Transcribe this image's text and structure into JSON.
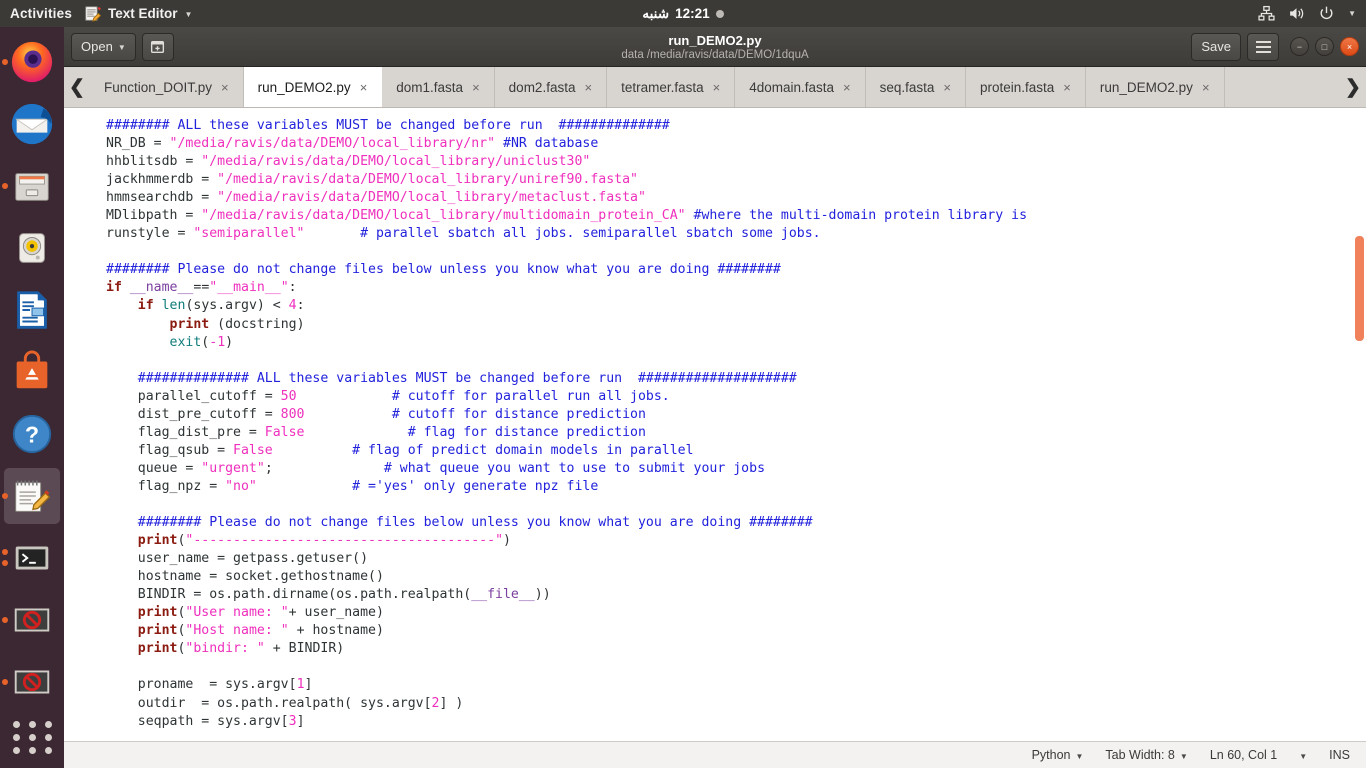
{
  "topbar": {
    "activities": "Activities",
    "app_name": "Text Editor",
    "app_icon": "text-editor-icon",
    "clock": "12:21",
    "clock_day": "شنبه",
    "tray_icons": [
      "network-icon",
      "volume-icon",
      "power-icon",
      "chevron-down-icon"
    ]
  },
  "dock": {
    "items": [
      {
        "name": "firefox",
        "running": true
      },
      {
        "name": "thunderbird",
        "running": false
      },
      {
        "name": "files",
        "running": true
      },
      {
        "name": "rhythmbox",
        "running": false
      },
      {
        "name": "libreoffice-writer",
        "running": false
      },
      {
        "name": "ubuntu-software",
        "running": false
      },
      {
        "name": "help",
        "running": false
      },
      {
        "name": "text-editor",
        "running": true
      },
      {
        "name": "terminal",
        "running": true
      },
      {
        "name": "blocked-window-1",
        "running": true
      },
      {
        "name": "blocked-window-2",
        "running": true
      }
    ],
    "show_apps_label": "Show Applications"
  },
  "headerbar": {
    "open_label": "Open",
    "new_tab_icon": "new-document-icon",
    "title": "run_DEMO2.py",
    "subtitle": "data /media/ravis/data/DEMO/1dquA",
    "save_label": "Save",
    "menu_icon": "hamburger-menu-icon",
    "minimize_label": "−",
    "maximize_label": "□",
    "close_label": "×"
  },
  "tabbar": {
    "scroll_left_icon": "chevron-left-icon",
    "scroll_right_icon": "chevron-right-icon",
    "close_glyph": "×",
    "tabs": [
      {
        "label": "Function_DOIT.py",
        "active": false
      },
      {
        "label": "run_DEMO2.py",
        "active": true
      },
      {
        "label": "dom1.fasta",
        "active": false
      },
      {
        "label": "dom2.fasta",
        "active": false
      },
      {
        "label": "tetramer.fasta",
        "active": false
      },
      {
        "label": "4domain.fasta",
        "active": false
      },
      {
        "label": "seq.fasta",
        "active": false
      },
      {
        "label": "protein.fasta",
        "active": false
      },
      {
        "label": "run_DEMO2.py",
        "active": false
      }
    ]
  },
  "editor": {
    "code": "######## ALL these variables MUST be changed before run  ##############\nNR_DB = \"/media/ravis/data/DEMO/local_library/nr\" #NR database\nhhblitsdb = \"/media/ravis/data/DEMO/local_library/uniclust30\"\njackhmmerdb = \"/media/ravis/data/DEMO/local_library/uniref90.fasta\"\nhmmsearchdb = \"/media/ravis/data/DEMO/local_library/metaclust.fasta\"\nMDlibpath = \"/media/ravis/data/DEMO/local_library/multidomain_protein_CA\" #where the multi-domain protein library is\nrunstyle = \"semiparallel\"       # parallel sbatch all jobs. semiparallel sbatch some jobs.\n\n######## Please do not change files below unless you know what you are doing ########\nif __name__==\"__main__\":\n    if len(sys.argv) < 4:\n        print (docstring)\n        exit(-1)\n\n    ############## ALL these variables MUST be changed before run  ####################\n    parallel_cutoff = 50            # cutoff for parallel run all jobs.\n    dist_pre_cutoff = 800           # cutoff for distance prediction\n    flag_dist_pre = False             # flag for distance prediction\n    flag_qsub = False          # flag of predict domain models in parallel\n    queue = \"urgent\";              # what queue you want to use to submit your jobs\n    flag_npz = \"no\"            # ='yes' only generate npz file\n\n    ######## Please do not change files below unless you know what you are doing ########\n    print(\"--------------------------------------\")\n    user_name = getpass.getuser()\n    hostname = socket.gethostname()\n    BINDIR = os.path.dirname(os.path.realpath(__file__))\n    print(\"User name: \"+ user_name)\n    print(\"Host name: \" + hostname)\n    print(\"bindir: \" + BINDIR)\n\n    proname  = sys.argv[1]\n    outdir  = os.path.realpath( sys.argv[2] )\n    seqpath = sys.argv[3]",
    "scrollbar_color": "#f0815a"
  },
  "statusbar": {
    "language": "Python",
    "tab_width": "Tab Width: 8",
    "position": "Ln 60, Col 1",
    "insert_mode": "INS"
  }
}
